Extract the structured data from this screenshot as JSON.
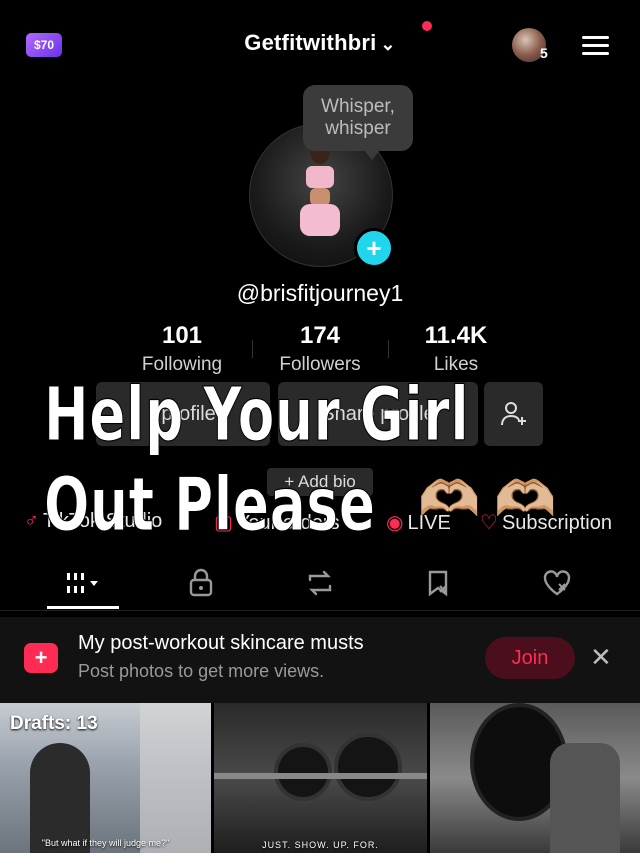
{
  "header": {
    "coin_label": "$70",
    "title": "Getfitwithbri",
    "chevron_icon": "chevron-down-icon",
    "friends_count": "5",
    "menu_icon": "hamburger-menu-icon"
  },
  "profile": {
    "bubble_text_1": "Whisper,",
    "bubble_text_2": "whisper",
    "add_icon": "+",
    "handle": "@brisfitjourney1"
  },
  "stats": [
    {
      "value": "101",
      "label": "Following"
    },
    {
      "value": "174",
      "label": "Followers"
    },
    {
      "value": "11.4K",
      "label": "Likes"
    }
  ],
  "actions": {
    "edit_fragment": "t profile",
    "share_fragment": "Share profile",
    "add_bio": "+ Add bio"
  },
  "quick_links": [
    {
      "icon": "♂",
      "label": "TikTok Studio"
    },
    {
      "icon": "▢",
      "label": "Your orders"
    },
    {
      "icon": "◉",
      "label": "LIVE"
    },
    {
      "icon": "♡",
      "label": "Subscription"
    }
  ],
  "overlay": {
    "line1": "Help Your Girl",
    "line2": "Out Please",
    "emoji": "🫶🏼 🫶🏼"
  },
  "tabs": [
    {
      "icon": "grid-icon",
      "glyph": "⦙⦙⦙▾"
    },
    {
      "icon": "lock-icon",
      "glyph": "🔒"
    },
    {
      "icon": "repost-icon",
      "glyph": "⟲"
    },
    {
      "icon": "bookmark-icon",
      "glyph": "⬒"
    },
    {
      "icon": "liked-icon",
      "glyph": "♡"
    }
  ],
  "banner": {
    "title": "My post-workout skincare musts",
    "subtitle": "Post photos to get more views.",
    "join_label": "Join",
    "close_glyph": "✕"
  },
  "grid": {
    "drafts_label": "Drafts: 13",
    "caption1": "\"But what if they will judge me?\"",
    "caption2": "JUST.  SHOW.  UP.  FOR."
  },
  "colors": {
    "accent": "#fe2c55",
    "cyan": "#20d5ec",
    "background": "#000000"
  }
}
